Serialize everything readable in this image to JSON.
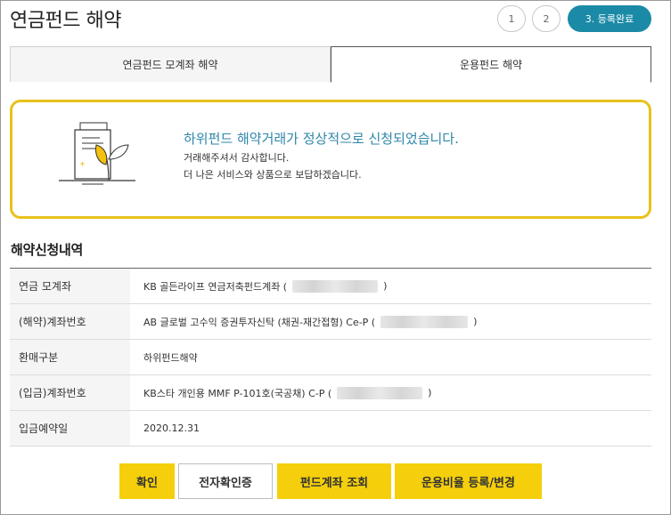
{
  "page": {
    "title": "연금펀드 해약"
  },
  "steps": [
    {
      "label": "1"
    },
    {
      "label": "2"
    },
    {
      "label": "3. 등록완료"
    }
  ],
  "tabs": [
    {
      "label": "연금펀드 모계좌 해약",
      "active": false
    },
    {
      "label": "운용펀드 해약",
      "active": true
    }
  ],
  "notice": {
    "heading": "하위펀드 해약거래가 정상적으로 신청되었습니다.",
    "line1": "거래해주셔서 감사합니다.",
    "line2": "더 나은 서비스와 상품으로 보답하겠습니다."
  },
  "details": {
    "title": "해약신청내역",
    "rows": [
      {
        "label": "연금 모계좌",
        "value": "KB 골든라이프 연금저축펀드계좌 (",
        "suffix": ")"
      },
      {
        "label": "(해약)계좌번호",
        "value": "AB 글로벌 고수익 증권투자신탁 (채권-재간접형) Ce-P (",
        "suffix": ")"
      },
      {
        "label": "환매구분",
        "value": "하위펀드해약",
        "suffix": ""
      },
      {
        "label": "(입금)계좌번호",
        "value": "KB스타 개인용 MMF P-101호(국공채) C-P (",
        "suffix": ")"
      },
      {
        "label": "입금예약일",
        "value": "2020.12.31",
        "suffix": ""
      }
    ]
  },
  "buttons": {
    "confirm": "확인",
    "e_cert": "전자확인증",
    "fund_account": "펀드계좌 조회",
    "ratio": "운용비율 등록/변경"
  },
  "colors": {
    "accent_teal": "#1b8aa6",
    "accent_yellow": "#f5cf0b",
    "notice_border": "#e8c21b",
    "heading_blue": "#2e86a8"
  }
}
